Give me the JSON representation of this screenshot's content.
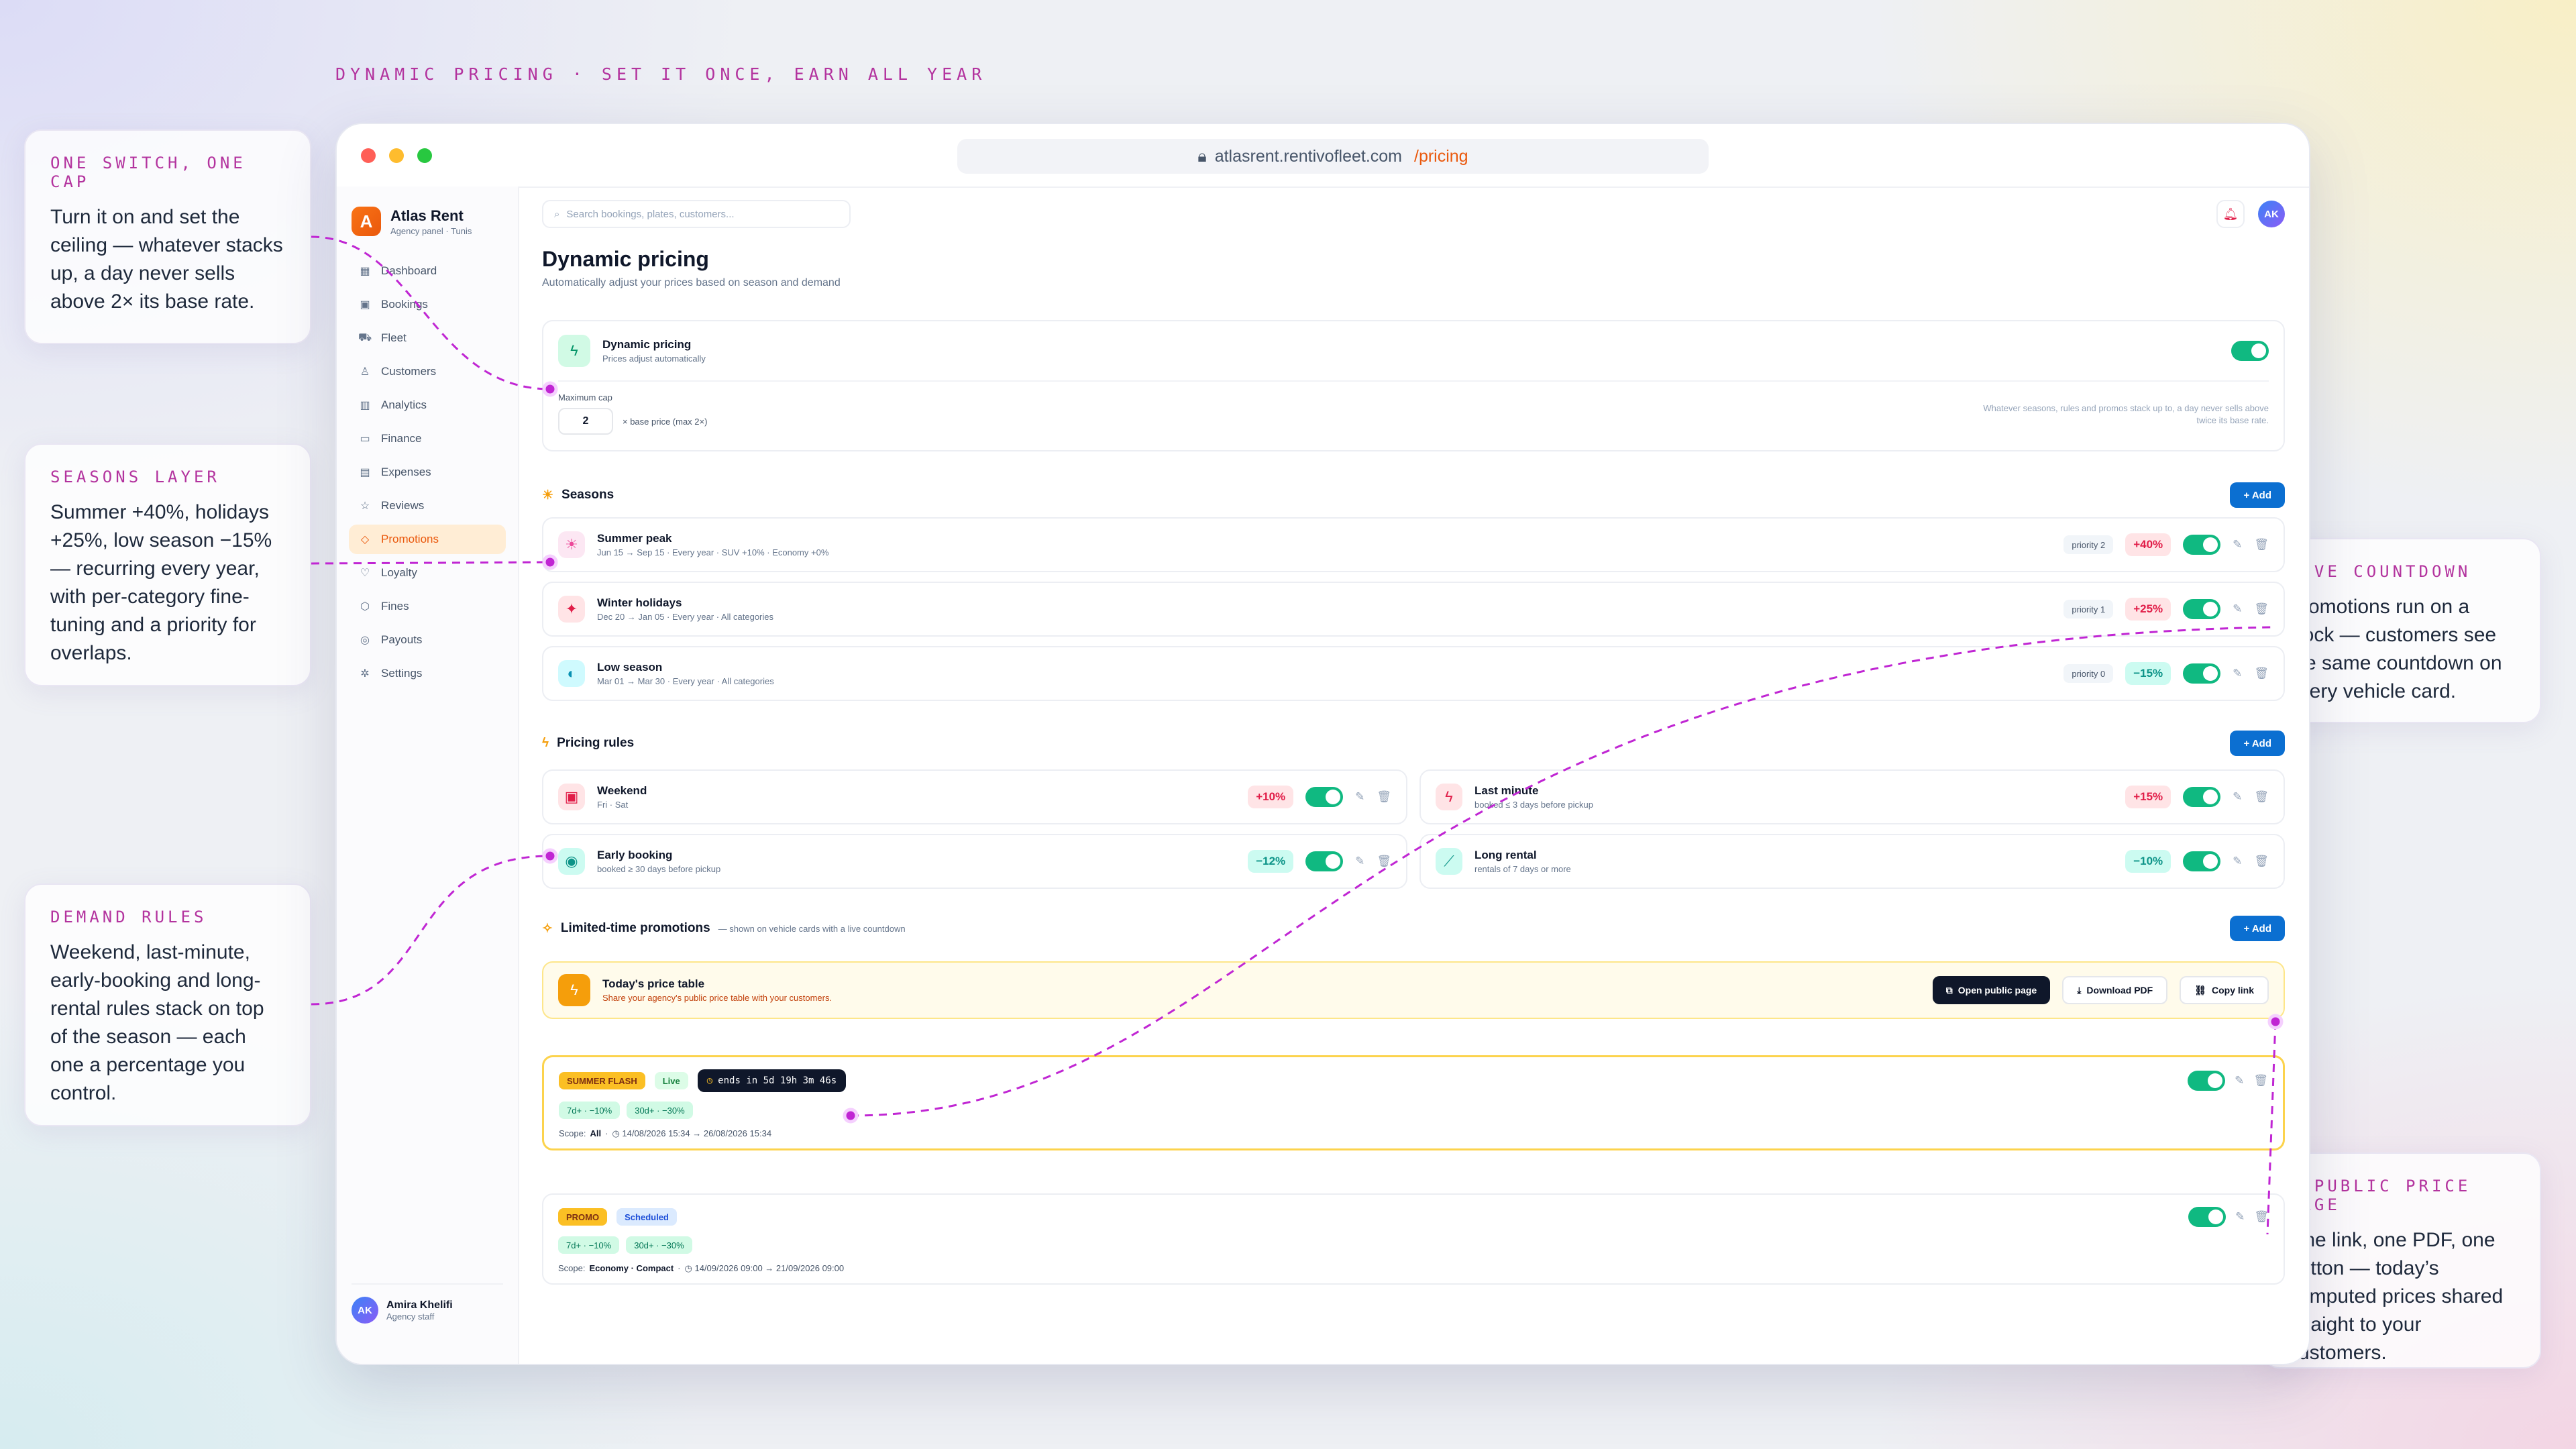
{
  "eyebrow": "DYNAMIC PRICING · SET IT ONCE, EARN ALL YEAR",
  "callouts": [
    {
      "title": "ONE SWITCH, ONE CAP",
      "body": "Turn it on and set the ceiling — whatever stacks up, a day never sells above 2× its base rate."
    },
    {
      "title": "SEASONS LAYER",
      "body": "Summer +40%, holidays +25%, low season −15% — recurring every year, with per-category fine-tuning and a priority for overlaps."
    },
    {
      "title": "DEMAND RULES",
      "body": "Weekend, last-minute, early-booking and long-rental rules stack on top of the season — each one a percentage you control."
    },
    {
      "title": "LIVE COUNTDOWN",
      "body": "Promotions run on a clock — customers see the same countdown on every vehicle card."
    },
    {
      "title": "A PUBLIC PRICE PAGE",
      "body": "One link, one PDF, one button — today’s computed prices shared straight to your customers."
    }
  ],
  "browser": {
    "host": "atlasrent.rentivofleet.com",
    "path": "/pricing"
  },
  "brand": {
    "logo": "A",
    "name": "Atlas Rent",
    "sub": "Agency panel · Tunis"
  },
  "nav": [
    {
      "label": "Dashboard",
      "icon": "▦"
    },
    {
      "label": "Bookings",
      "icon": "▣"
    },
    {
      "label": "Fleet",
      "icon": "⛟"
    },
    {
      "label": "Customers",
      "icon": "♙"
    },
    {
      "label": "Analytics",
      "icon": "▥"
    },
    {
      "label": "Finance",
      "icon": "▭"
    },
    {
      "label": "Expenses",
      "icon": "▤"
    },
    {
      "label": "Reviews",
      "icon": "☆"
    },
    {
      "label": "Promotions",
      "icon": "◇"
    },
    {
      "label": "Loyalty",
      "icon": "♡"
    },
    {
      "label": "Fines",
      "icon": "⬡"
    },
    {
      "label": "Payouts",
      "icon": "◎"
    },
    {
      "label": "Settings",
      "icon": "✲"
    }
  ],
  "user": {
    "initials": "AK",
    "name": "Amira Khelifi",
    "role": "Agency staff"
  },
  "search_placeholder": "Search bookings, plates, customers...",
  "page": {
    "title": "Dynamic pricing",
    "subtitle": "Automatically adjust your prices based on season and demand"
  },
  "master": {
    "title": "Dynamic pricing",
    "sub": "Prices adjust automatically",
    "cap_label": "Maximum cap",
    "cap_value": "2",
    "cap_hint": "× base price (max 2×)",
    "note": "Whatever seasons, rules and promos stack up to, a day never sells above twice its base rate.",
    "enabled": true
  },
  "seasons": {
    "title": "Seasons",
    "add": "+ Add",
    "items": [
      {
        "name": "Summer peak",
        "meta": "Jun 15 → Sep 15 · Every year · SUV +10% · Economy +0%",
        "priority": "priority 2",
        "pct": "+40%",
        "sign": "pos",
        "icon": "☀",
        "color": "#ec4899",
        "bg": "#fce7f3"
      },
      {
        "name": "Winter holidays",
        "meta": "Dec 20 → Jan 05 · Every year · All categories",
        "priority": "priority 1",
        "pct": "+25%",
        "sign": "pos",
        "icon": "✦",
        "color": "#e11d48",
        "bg": "#ffe4e6"
      },
      {
        "name": "Low season",
        "meta": "Mar 01 → Mar 30 · Every year · All categories",
        "priority": "priority 0",
        "pct": "−15%",
        "sign": "neg",
        "icon": "◐",
        "color": "#0891b2",
        "bg": "#cffafe"
      }
    ]
  },
  "rules": {
    "title": "Pricing rules",
    "add": "+ Add",
    "items": [
      {
        "name": "Weekend",
        "meta": "Fri · Sat",
        "pct": "+10%",
        "sign": "pos",
        "icon": "▣",
        "color": "#e11d48",
        "bg": "#ffe4e6"
      },
      {
        "name": "Last minute",
        "meta": "booked ≤ 3 days before pickup",
        "pct": "+15%",
        "sign": "pos",
        "icon": "ϟ",
        "color": "#e11d48",
        "bg": "#ffe4e6"
      },
      {
        "name": "Early booking",
        "meta": "booked ≥ 30 days before pickup",
        "pct": "−12%",
        "sign": "neg",
        "icon": "◉",
        "color": "#0d9488",
        "bg": "#ccfbf1"
      },
      {
        "name": "Long rental",
        "meta": "rentals of 7 days or more",
        "pct": "−10%",
        "sign": "neg",
        "icon": "⟋",
        "color": "#0d9488",
        "bg": "#ccfbf1"
      }
    ]
  },
  "promos": {
    "title": "Limited-time promotions",
    "note": "— shown on vehicle cards with a live countdown",
    "add": "+ Add",
    "price_table": {
      "title": "Today's price table",
      "sub": "Share your agency's public price table with your customers.",
      "open": "Open public page",
      "pdf": "Download PDF",
      "copy": "Copy link"
    },
    "items": [
      {
        "badge": "SUMMER FLASH",
        "status": "Live",
        "status_kind": "live",
        "countdown": "ends in 5d 19h 3m 46s",
        "tiers": [
          "7d+ · −10%",
          "30d+ · −30%"
        ],
        "scope_label": "Scope:",
        "scope": "All",
        "dates": "◷ 14/08/2026 15:34 → 26/08/2026 15:34",
        "highlight": true
      },
      {
        "badge": "PROMO",
        "status": "Scheduled",
        "status_kind": "sched",
        "countdown": "",
        "tiers": [
          "7d+ · −10%",
          "30d+ · −30%"
        ],
        "scope_label": "Scope:",
        "scope": "Economy · Compact",
        "dates": "◷ 14/09/2026 09:00 → 21/09/2026 09:00",
        "highlight": false
      }
    ]
  },
  "colors": {
    "accent": "#b3339e",
    "brand": "#ea580c",
    "primary": "#0b6fd1",
    "toggle": "#10b981"
  }
}
